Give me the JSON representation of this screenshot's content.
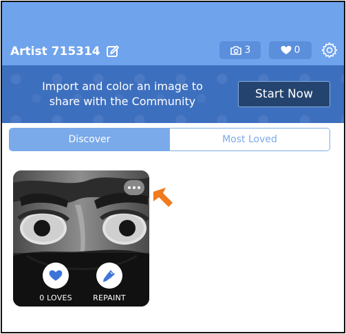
{
  "header": {
    "artist_name": "Artist 715314",
    "photo_count": "3",
    "love_count": "0"
  },
  "banner": {
    "line1": "Import and color an image to",
    "line2": "share with the Community",
    "cta_label": "Start Now"
  },
  "tabs": [
    {
      "label": "Discover",
      "active": true
    },
    {
      "label": "Most Loved",
      "active": false
    }
  ],
  "card": {
    "loves_label": "0 LOVES",
    "repaint_label": "REPAINT"
  },
  "colors": {
    "header_bg": "#6fa3ec",
    "banner_bg": "#3d6fbf",
    "cta_bg": "#24446f",
    "tab_accent": "#7aaae9",
    "icon_blue": "#3b74d8",
    "annotation_arrow": "#f07a1e"
  },
  "icons": [
    "edit-icon",
    "camera-icon",
    "heart-icon",
    "gear-icon",
    "more-icon",
    "paintbrush-icon",
    "arrow-icon"
  ]
}
